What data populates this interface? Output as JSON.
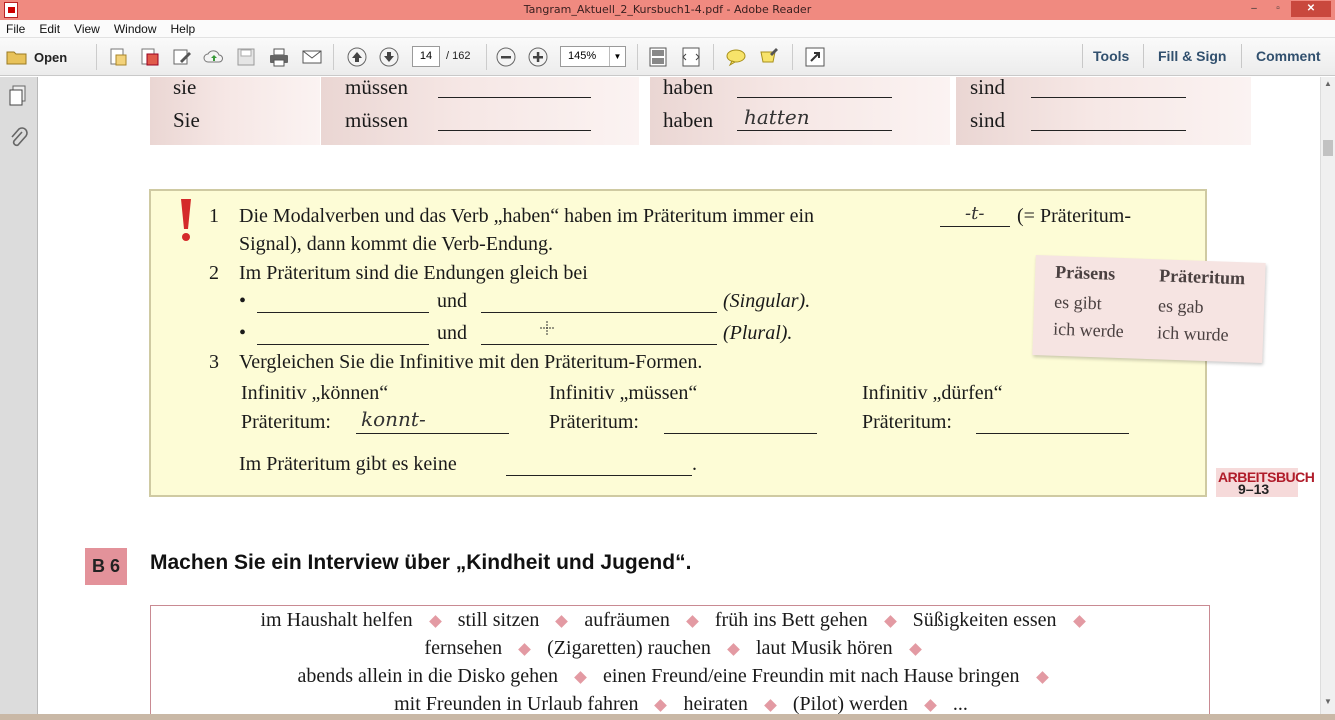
{
  "window": {
    "title": "Tangram_Aktuell_2_Kursbuch1-4.pdf - Adobe Reader",
    "controls": [
      "–",
      "▫",
      "✕"
    ]
  },
  "menu": [
    "File",
    "Edit",
    "View",
    "Window",
    "Help"
  ],
  "toolbar": {
    "open_label": "Open",
    "page_current": "14",
    "page_total": "/ 162",
    "zoom": "145%",
    "links": {
      "tools": "Tools",
      "fill_sign": "Fill & Sign",
      "comment": "Comment"
    }
  },
  "doc": {
    "top_table": {
      "col1": [
        "sie",
        "Sie"
      ],
      "col2": [
        "müssen",
        "müssen"
      ],
      "col3": [
        "haben",
        "haben"
      ],
      "col3_answer": "hatten",
      "col4": [
        "sind",
        "sind"
      ]
    },
    "rules": {
      "n1": "1",
      "l1a": "Die Modalverben und das Verb „haben“ haben im Präteritum immer ein",
      "l1_answer": "-t-",
      "l1b": "(= Präteritum-",
      "l1c": "Signal), dann kommt die Verb-Endung.",
      "n2": "2",
      "l2": "Im Präteritum sind die Endungen gleich bei",
      "bullet": "•",
      "und": "und",
      "singular": "(Singular).",
      "plural": "(Plural).",
      "n3": "3",
      "l3": "Vergleichen Sie die Infinitive mit den Präteritum-Formen.",
      "inf1": "Infinitiv „können“",
      "inf2": "Infinitiv „müssen“",
      "inf3": "Infinitiv „dürfen“",
      "praet_label": "Präteritum:",
      "praet1_answer": "konnt-",
      "last_a": "Im Präteritum gibt es keine",
      "last_b": "."
    },
    "card": {
      "h1": "Präsens",
      "h2": "Präteritum",
      "r1a": "es gibt",
      "r1b": "es gab",
      "r2a": "ich werde",
      "r2b": "ich wurde"
    },
    "arbeitsbuch": {
      "label": "ARBEITSBUCH",
      "pages": "9–13"
    },
    "section": {
      "badge": "B 6",
      "title": "Machen Sie ein Interview über „Kindheit und Jugend“."
    },
    "words": [
      [
        "im Haushalt helfen",
        "still sitzen",
        "aufräumen",
        "früh ins Bett gehen",
        "Süßigkeiten essen"
      ],
      [
        "fernsehen",
        "(Zigaretten) rauchen",
        "laut Musik hören"
      ],
      [
        "abends allein in die Disko gehen",
        "einen Freund/eine Freundin mit nach Hause bringen"
      ],
      [
        "mit Freunden in Urlaub fahren",
        "heiraten",
        "(Pilot) werden",
        "..."
      ]
    ]
  },
  "colors": {
    "titlebar": "#f08a80",
    "accent_link": "#31506e",
    "rule_box": "#fdfcd6",
    "badge": "#e3929a",
    "diamond": "#e39aa3"
  }
}
